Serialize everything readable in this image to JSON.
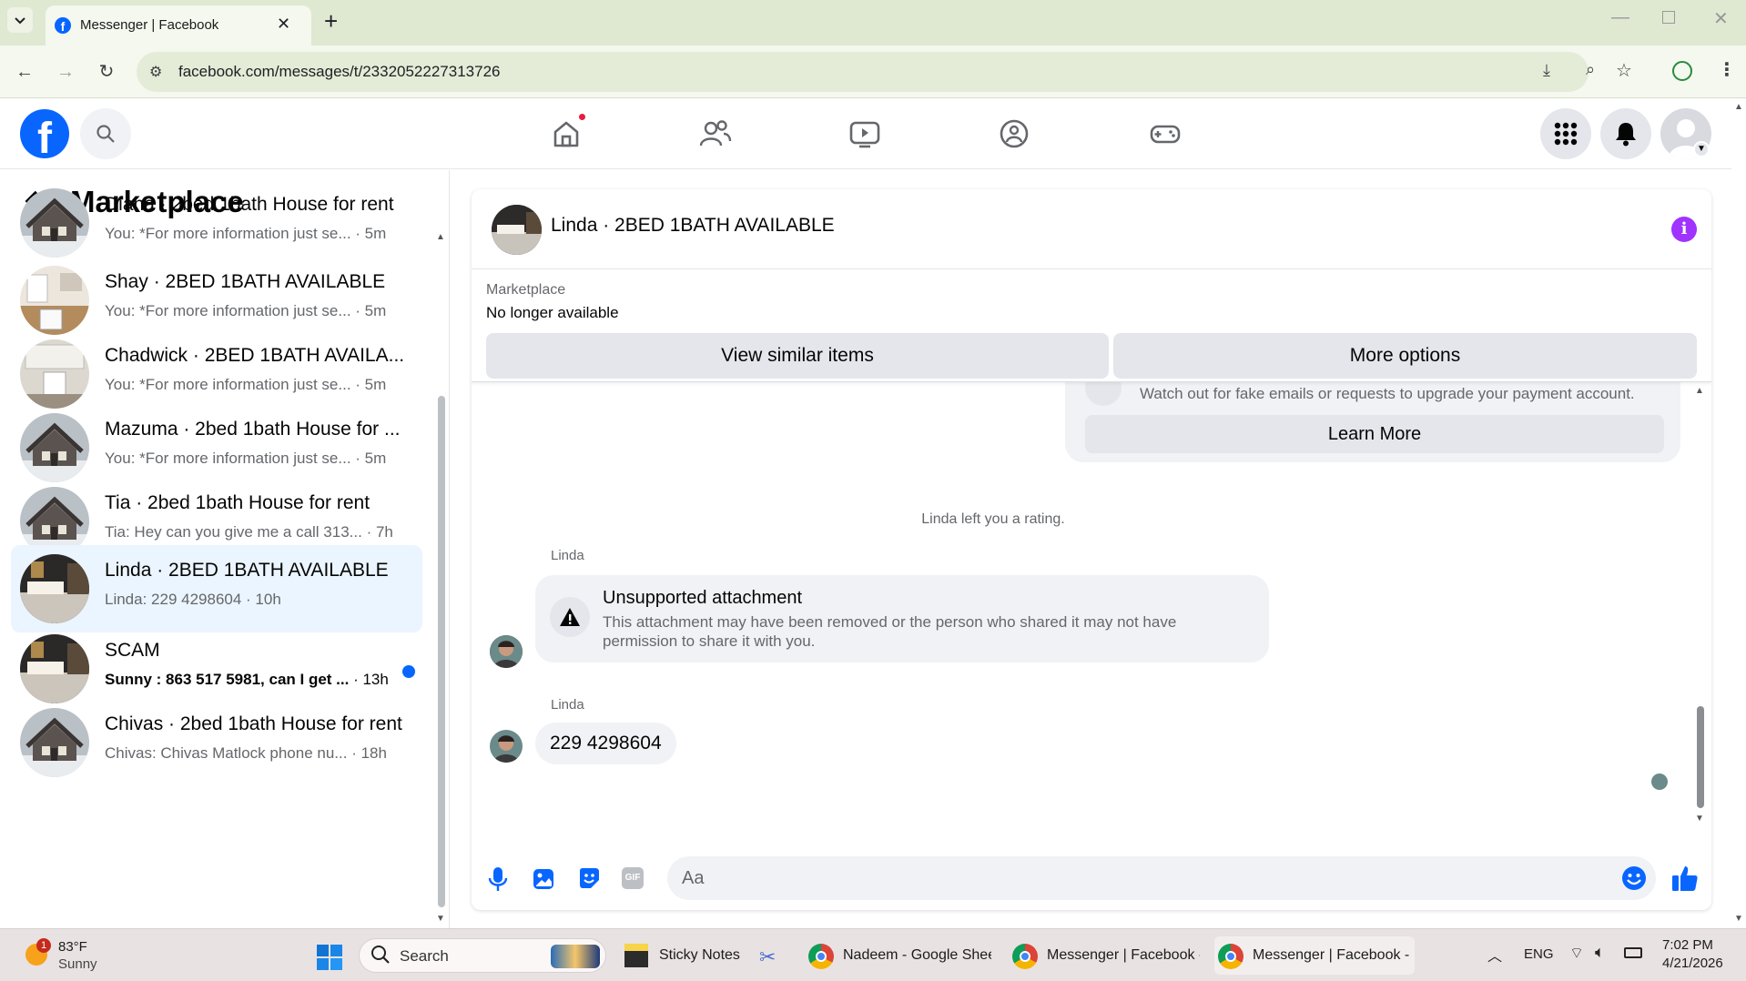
{
  "browser": {
    "tab_title": "Messenger | Facebook",
    "url": "facebook.com/messages/t/2332052227313726"
  },
  "left": {
    "title": "Marketplace",
    "conversations": [
      {
        "name": "Diana · 2bed 1bath House for rent",
        "preview": "You: *For more information just se...",
        "time": "· 5m",
        "avatar": "house"
      },
      {
        "name": "Shay · 2BED 1BATH AVAILABLE",
        "preview": "You: *For more information just se...",
        "time": "· 5m",
        "avatar": "kitchen"
      },
      {
        "name": "Chadwick · 2BED 1BATH AVAILA...",
        "preview": "You: *For more information just se...",
        "time": "· 5m",
        "avatar": "kitchen2"
      },
      {
        "name": "Mazuma · 2bed 1bath House for ...",
        "preview": "You: *For more information just se...",
        "time": "· 5m",
        "avatar": "house"
      },
      {
        "name": "Tia · 2bed 1bath House for rent",
        "preview": "Tia: Hey can you give me a call 313...",
        "time": "· 7h",
        "avatar": "house"
      },
      {
        "name": "Linda · 2BED 1BATH AVAILABLE",
        "preview": "Linda: 229 4298604",
        "time": "· 10h",
        "avatar": "dark"
      },
      {
        "name": "SCAM",
        "preview": "Sunny : 863 517 5981, can I get ...",
        "time": "· 13h",
        "avatar": "dark"
      },
      {
        "name": "Chivas · 2bed 1bath House for rent",
        "preview": "Chivas: Chivas Matlock phone nu...",
        "time": "· 18h",
        "avatar": "house"
      }
    ]
  },
  "chat": {
    "title": "Linda · 2BED 1BATH AVAILABLE",
    "marketplace_label": "Marketplace",
    "status": "No longer available",
    "view_similar": "View similar items",
    "more_options": "More options",
    "warning_text": "Watch out for fake emails or requests to upgrade your payment account.",
    "learn_more": "Learn More",
    "rating_notice": "Linda left you a rating.",
    "sender1": "Linda",
    "attachment_title": "Unsupported attachment",
    "attachment_body1": "This attachment may have been removed or the person who shared it may not have",
    "attachment_body2": "permission to share it with you.",
    "sender2": "Linda",
    "message": "229 4298604",
    "composer_placeholder": "Aa"
  },
  "taskbar": {
    "weather_temp": "83°F",
    "weather_desc": "Sunny",
    "weather_badge": "1",
    "search": "Search",
    "apps": [
      "Sticky Notes",
      "Nadeem - Google Sheet",
      "Messenger | Facebook -",
      "Messenger | Facebook -"
    ],
    "lang": "ENG",
    "time": "7:02 PM",
    "date": "4/21/2026"
  },
  "colors": {
    "fb_blue": "#0866ff",
    "selected_bg": "#ebf5ff",
    "info_purple": "#a033ff",
    "notif_red": "#e41e3f"
  }
}
